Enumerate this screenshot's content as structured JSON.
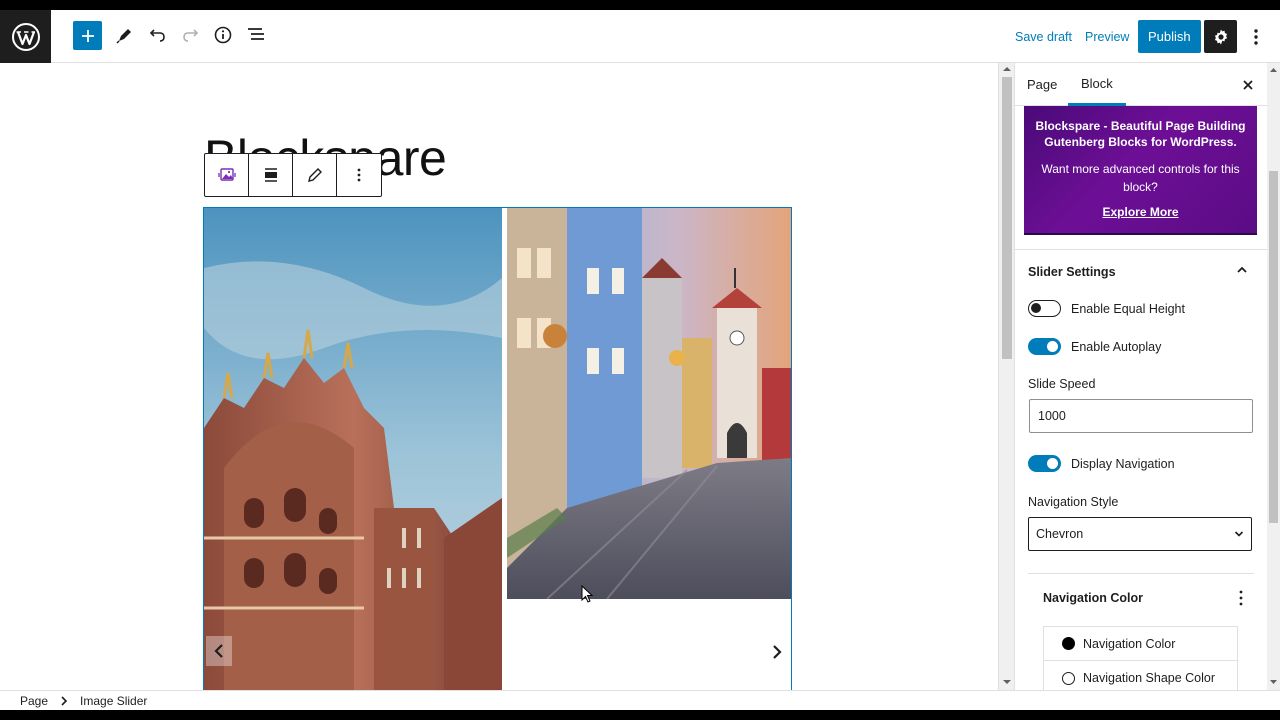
{
  "toolbar": {
    "save_draft": "Save draft",
    "preview": "Preview",
    "publish": "Publish",
    "icons": [
      "wordpress-logo",
      "add-block-icon",
      "pen-tool-icon",
      "undo-icon",
      "redo-icon",
      "info-icon",
      "list-view-icon",
      "settings-icon",
      "more-options-icon"
    ]
  },
  "editor": {
    "title": "Blockspare"
  },
  "sidebar": {
    "tabs": [
      "Page",
      "Block"
    ],
    "active_tab": "Block",
    "promo": {
      "title": "Blockspare - Beautiful Page Building Gutenberg Blocks for WordPress.",
      "text": "Want more advanced controls for this block?",
      "link": "Explore More"
    },
    "slider_settings": {
      "heading": "Slider Settings",
      "enable_equal_height": "Enable Equal Height",
      "equal_height_on": false,
      "enable_autoplay": "Enable Autoplay",
      "autoplay_on": true,
      "slide_speed_label": "Slide Speed",
      "slide_speed_value": "1000",
      "display_navigation": "Display Navigation",
      "navigation_on": true,
      "navigation_style_label": "Navigation Style",
      "navigation_style_value": "Chevron"
    },
    "navigation_color": {
      "heading": "Navigation Color",
      "items": [
        {
          "label": "Navigation Color",
          "swatch": "#000000"
        },
        {
          "label": "Navigation Shape Color",
          "swatch": "#ffffff"
        }
      ]
    }
  },
  "breadcrumb": {
    "items": [
      "Page",
      "Image Slider"
    ]
  },
  "colors": {
    "accent": "#007cba",
    "promo_purple": "#5b0c85"
  }
}
